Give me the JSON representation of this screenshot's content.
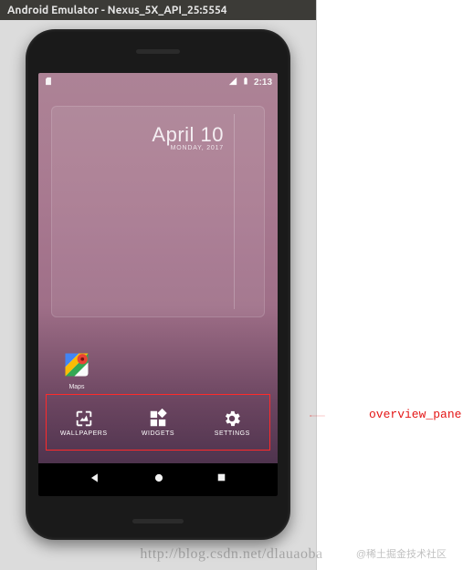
{
  "window": {
    "title": "Android Emulator - Nexus_5X_API_25:5554"
  },
  "status": {
    "time": "2:13"
  },
  "clock": {
    "date_main": "April 10",
    "date_sub": "MONDAY, 2017"
  },
  "app": {
    "maps_label": "Maps"
  },
  "overview": {
    "wallpapers": "WALLPAPERS",
    "widgets": "WIDGETS",
    "settings": "SETTINGS"
  },
  "annotation": {
    "label": "overview_panel"
  },
  "watermarks": {
    "url": "http://blog.csdn.net/dlauaoba",
    "badge": "@稀土掘金技术社区"
  }
}
